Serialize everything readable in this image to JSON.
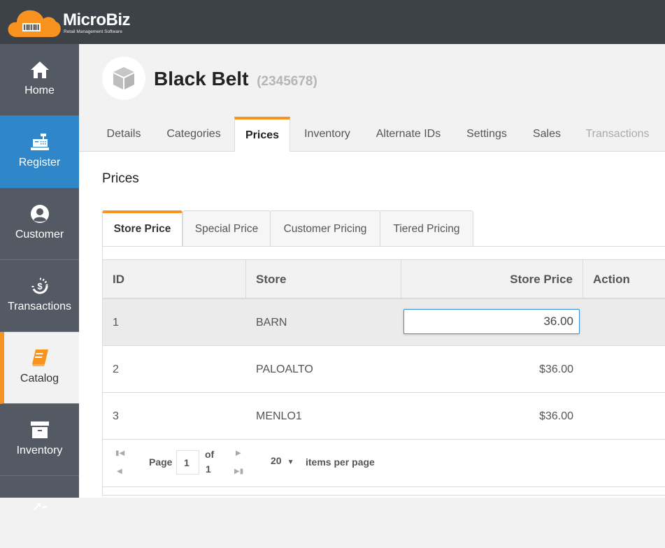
{
  "app": {
    "name": "MicroBiz",
    "tagline": "Retail Management Software",
    "brand_color": "#f7931e",
    "accent_color": "#2f87c9"
  },
  "sidebar": {
    "items": [
      {
        "label": "Home",
        "icon": "home-icon"
      },
      {
        "label": "Register",
        "icon": "cash-register-icon",
        "state": "highlighted"
      },
      {
        "label": "Customer",
        "icon": "user-circle-icon"
      },
      {
        "label": "Transactions",
        "icon": "dollar-cycle-icon"
      },
      {
        "label": "Catalog",
        "icon": "book-icon",
        "state": "active"
      },
      {
        "label": "Inventory",
        "icon": "archive-box-icon"
      }
    ]
  },
  "product": {
    "name": "Black Belt",
    "sku": "(2345678)",
    "icon": "cube-icon"
  },
  "tabs": [
    {
      "label": "Details"
    },
    {
      "label": "Categories"
    },
    {
      "label": "Prices",
      "active": true
    },
    {
      "label": "Inventory"
    },
    {
      "label": "Alternate IDs"
    },
    {
      "label": "Settings"
    },
    {
      "label": "Sales"
    },
    {
      "label": "Transactions",
      "disabled": true
    }
  ],
  "prices": {
    "section_title": "Prices",
    "subtabs": [
      {
        "label": "Store Price",
        "active": true
      },
      {
        "label": "Special Price"
      },
      {
        "label": "Customer Pricing"
      },
      {
        "label": "Tiered Pricing"
      }
    ],
    "columns": [
      "ID",
      "Store",
      "Store Price",
      "Action"
    ],
    "rows": [
      {
        "id": "1",
        "store": "BARN",
        "price": "36.00",
        "editing": true
      },
      {
        "id": "2",
        "store": "PALOALTO",
        "price": "$36.00"
      },
      {
        "id": "3",
        "store": "MENLO1",
        "price": "$36.00"
      }
    ],
    "pager": {
      "page_label": "Page",
      "current_page": "1",
      "of_label": "of",
      "total_pages": "1",
      "page_size": "20",
      "items_per_page_label": "items per page"
    }
  }
}
